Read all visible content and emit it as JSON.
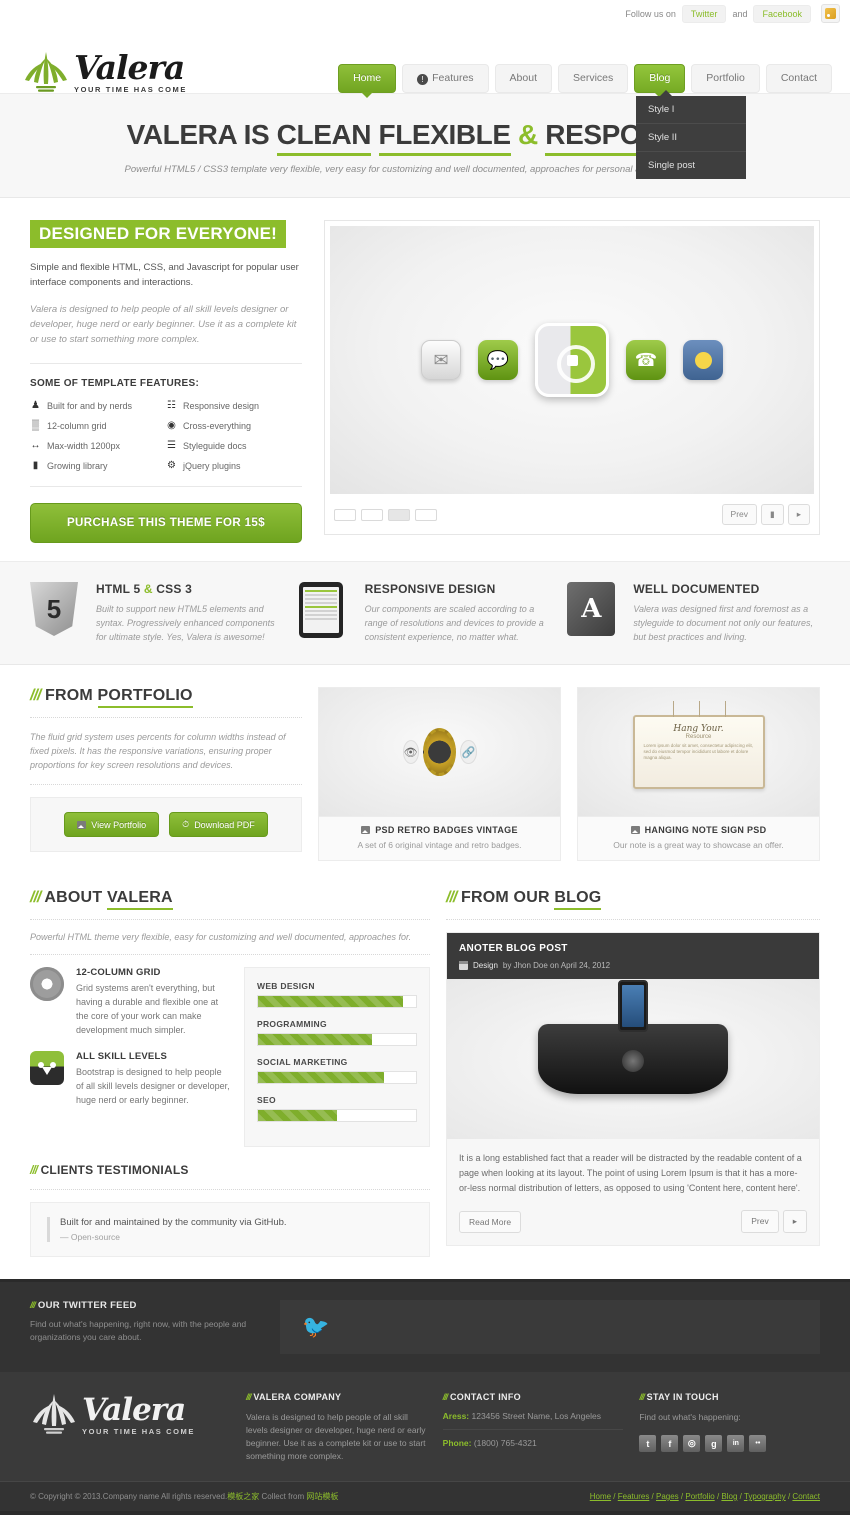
{
  "colors": {
    "accent": "#8cbd2b",
    "dark": "#3a3a3a",
    "text": "#555555"
  },
  "topbar": {
    "follow_label": "Follow us on",
    "twitter": "Twitter",
    "and": "and",
    "facebook": "Facebook",
    "rss_icon": "rss-icon"
  },
  "logo": {
    "name": "Valera",
    "tagline": "YOUR TIME HAS COME"
  },
  "nav": {
    "items": [
      {
        "label": "Home",
        "active": true,
        "badge": ""
      },
      {
        "label": "Features",
        "active": false,
        "badge": "!"
      },
      {
        "label": "About",
        "active": false,
        "badge": ""
      },
      {
        "label": "Services",
        "active": false,
        "badge": ""
      },
      {
        "label": "Blog",
        "active": true,
        "badge": ""
      },
      {
        "label": "Portfolio",
        "active": false,
        "badge": ""
      },
      {
        "label": "Contact",
        "active": false,
        "badge": ""
      }
    ],
    "dropdown": [
      "Style I",
      "Style II",
      "Single post"
    ]
  },
  "hero": {
    "t1": "VALERA IS ",
    "t2": "CLEAN",
    "t3": "FLEXIBLE",
    "amp": "&",
    "t4": "RESPONSIVE",
    "subtitle": "Powerful HTML5 / CSS3 template very flexible, very easy for customizing and well documented, approaches for personal and professional use."
  },
  "intro": {
    "badge": "DESIGNED FOR EVERYONE!",
    "lead": "Simple and flexible HTML, CSS, and Javascript for popular user interface components and interactions.",
    "italic": "Valera is designed to help people of all skill levels designer or developer, huge nerd or early beginner. Use it as a complete kit or use to start something more complex.",
    "features_heading": "SOME OF TEMPLATE FEATURES:",
    "features": [
      {
        "icon": "person-icon",
        "glyph": "♟",
        "label": "Built for and by nerds"
      },
      {
        "icon": "grid-icon",
        "glyph": "☷",
        "label": "Responsive design"
      },
      {
        "icon": "columns-icon",
        "glyph": "▒",
        "label": "12-column grid"
      },
      {
        "icon": "eye-icon",
        "glyph": "◉",
        "label": "Cross-everything"
      },
      {
        "icon": "arrows-icon",
        "glyph": "↔",
        "label": "Max-width 1200px"
      },
      {
        "icon": "book-icon",
        "glyph": "☰",
        "label": "Styleguide docs"
      },
      {
        "icon": "library-icon",
        "glyph": "▮",
        "label": "Growing library"
      },
      {
        "icon": "gear-icon",
        "glyph": "⚙",
        "label": "jQuery plugins"
      }
    ],
    "buy_button": "PURCHASE THIS THEME FOR 15$"
  },
  "slider": {
    "icons": [
      "mail-icon",
      "chat-icon",
      "center-app-icon",
      "phone-icon",
      "weather-icon"
    ],
    "thumbs": 4,
    "active_thumb": 3,
    "prev": "Prev",
    "pause": "▮",
    "next": "▸"
  },
  "fstrip": [
    {
      "icon": "html5-shield-icon",
      "title_a": "HTML 5 ",
      "title_amp": "&",
      "title_b": " CSS 3",
      "text": "Built to support new HTML5 elements and syntax. Progressively enhanced components for ultimate style. Yes, Valera is awesome!"
    },
    {
      "icon": "tablet-icon",
      "title_a": "RESPONSIVE DESIGN",
      "title_amp": "",
      "title_b": "",
      "text": "Our components are scaled according to a range of resolutions and devices to provide a consistent experience, no matter what."
    },
    {
      "icon": "adobe-icon",
      "title_a": "WELL DOCUMENTED",
      "title_amp": "",
      "title_b": "",
      "text": "Valera was designed first and foremost as a styleguide to document not only our features, but best practices and living."
    }
  ],
  "portfolio": {
    "slashes": "///",
    "head_a": "FROM ",
    "head_b": "PORTFOLIO",
    "text": "The fluid grid system uses percents for column widths instead of fixed pixels. It has the responsive variations, ensuring proper proportions for key screen resolutions and devices.",
    "btn_view": "View Portfolio",
    "btn_pdf": "Download PDF",
    "cards": [
      {
        "title": "PSD RETRO BADGES VINTAGE",
        "caption": "A set of 6 original vintage and retro badges."
      },
      {
        "title": "HANGING NOTE SIGN PSD",
        "caption": "Our note is a great way to showcase an offer."
      }
    ],
    "note_art": {
      "title": "Hang Your.",
      "sub": "Resource",
      "body": "Lorem ipsum dolor sit amet, consectetur adipiscing elit, sed do eiusmod tempor incididunt ut labore et dolore magna aliqua."
    }
  },
  "about": {
    "slashes": "///",
    "head_a": "ABOUT ",
    "head_b": "VALERA",
    "lead": "Powerful HTML theme very flexible, easy for customizing and well documented, approaches for.",
    "items": [
      {
        "icon": "gear-icon",
        "title": "12-COLUMN GRID",
        "text": "Grid systems aren't everything, but having a durable and flexible one at the core of your work can make development much simpler."
      },
      {
        "icon": "suit-avatar-icon",
        "title": "ALL SKILL LEVELS",
        "text": "Bootstrap is designed to help people of all skill levels designer or developer, huge nerd or early beginner."
      }
    ],
    "bars": [
      {
        "label": "WEB DESIGN",
        "value": 92
      },
      {
        "label": "PROGRAMMING",
        "value": 72
      },
      {
        "label": "SOCIAL MARKETING",
        "value": 80
      },
      {
        "label": "SEO",
        "value": 50
      }
    ]
  },
  "testimonials": {
    "slashes": "///",
    "head": "CLIENTS TESTIMONIALS",
    "quote": "Built for and maintained by the community via GitHub.",
    "author": "— Open-source"
  },
  "blog": {
    "slashes": "///",
    "head_a": "FROM OUR ",
    "head_b": "BLOG",
    "post_title": "ANOTER BLOG POST",
    "meta_a": "Design",
    "meta_b": " by Jhon Doe on April 24, 2012",
    "excerpt": "It is a long established fact that a reader will be distracted by the readable content of a page when looking at its layout. The point of using Lorem Ipsum is that it has a more-or-less normal distribution of letters, as opposed to using 'Content here, content here'.",
    "read_more": "Read More",
    "prev": "Prev",
    "next": "▸"
  },
  "twitter_feed": {
    "slashes": "///",
    "head": "OUR TWITTER FEED",
    "text": "Find out what's happening, right now, with the people and organizations you care about.",
    "icon": "twitter-bird-icon"
  },
  "footer": {
    "logo": {
      "name": "Valera",
      "tagline": "YOUR TIME HAS COME"
    },
    "company": {
      "slashes": "///",
      "head": "VALERA COMPANY",
      "text": "Valera is designed to help people of all skill levels designer or developer, huge nerd or early beginner. Use it as a complete kit or use to start something more complex."
    },
    "contact": {
      "slashes": "///",
      "head": "CONTACT INFO",
      "address_label": "Aress:",
      "address_value": " 123456 Street Name, Los Angeles",
      "phone_label": "Phone:",
      "phone_value": " (1800) 765-4321"
    },
    "touch": {
      "slashes": "///",
      "head": "STAY IN TOUCH",
      "text": "Find out what's happening:",
      "socials": [
        {
          "name": "twitter-icon",
          "glyph": "t"
        },
        {
          "name": "facebook-icon",
          "glyph": "f"
        },
        {
          "name": "dribbble-icon",
          "glyph": "◎"
        },
        {
          "name": "google-plus-icon",
          "glyph": "g"
        },
        {
          "name": "linkedin-icon",
          "glyph": "in"
        },
        {
          "name": "flickr-icon",
          "glyph": "••"
        }
      ]
    },
    "bottom": {
      "copyright_a": "© Copyright © 2013.Company name All rights reserved.",
      "cn1": "模板之家",
      "copyright_b": " Collect from ",
      "cn2": "网站模板",
      "links": [
        "Home",
        "Features",
        "Pages",
        "Portfolio",
        "Blog",
        "Typography",
        "Contact"
      ]
    }
  }
}
